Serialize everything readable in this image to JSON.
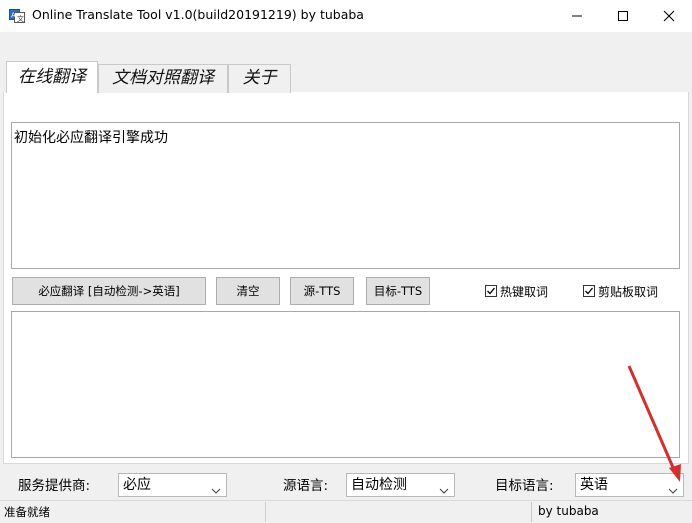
{
  "window": {
    "title": "Online Translate Tool v1.0(build20191219) by tubaba",
    "app_icon": "translate-app-icon",
    "controls": [
      "minimize-icon",
      "maximize-icon",
      "close-icon"
    ]
  },
  "tabs": [
    {
      "label": "在线翻译",
      "active": true
    },
    {
      "label": "文档对照翻译",
      "active": false
    },
    {
      "label": "关于",
      "active": false
    }
  ],
  "source_text": "初始化必应翻译引擎成功",
  "target_text": "",
  "buttons": {
    "translate": "必应翻译 [自动检测->英语]",
    "clear": "清空",
    "source_tts": "源-TTS",
    "target_tts": "目标-TTS"
  },
  "checkboxes": [
    {
      "label": "热键取词",
      "checked": true
    },
    {
      "label": "剪贴板取词",
      "checked": true
    }
  ],
  "options": {
    "provider_label": "服务提供商:",
    "provider_value": "必应",
    "source_lang_label": "源语言:",
    "source_lang_value": "自动检测",
    "target_lang_label": "目标语言:",
    "target_lang_value": "英语"
  },
  "statusbar": {
    "status": "准备就绪",
    "author": "by tubaba"
  },
  "colors": {
    "annotation_arrow": "#d32f2f",
    "button_face": "#e1e1e1",
    "window_bg": "#f0f0f0"
  }
}
